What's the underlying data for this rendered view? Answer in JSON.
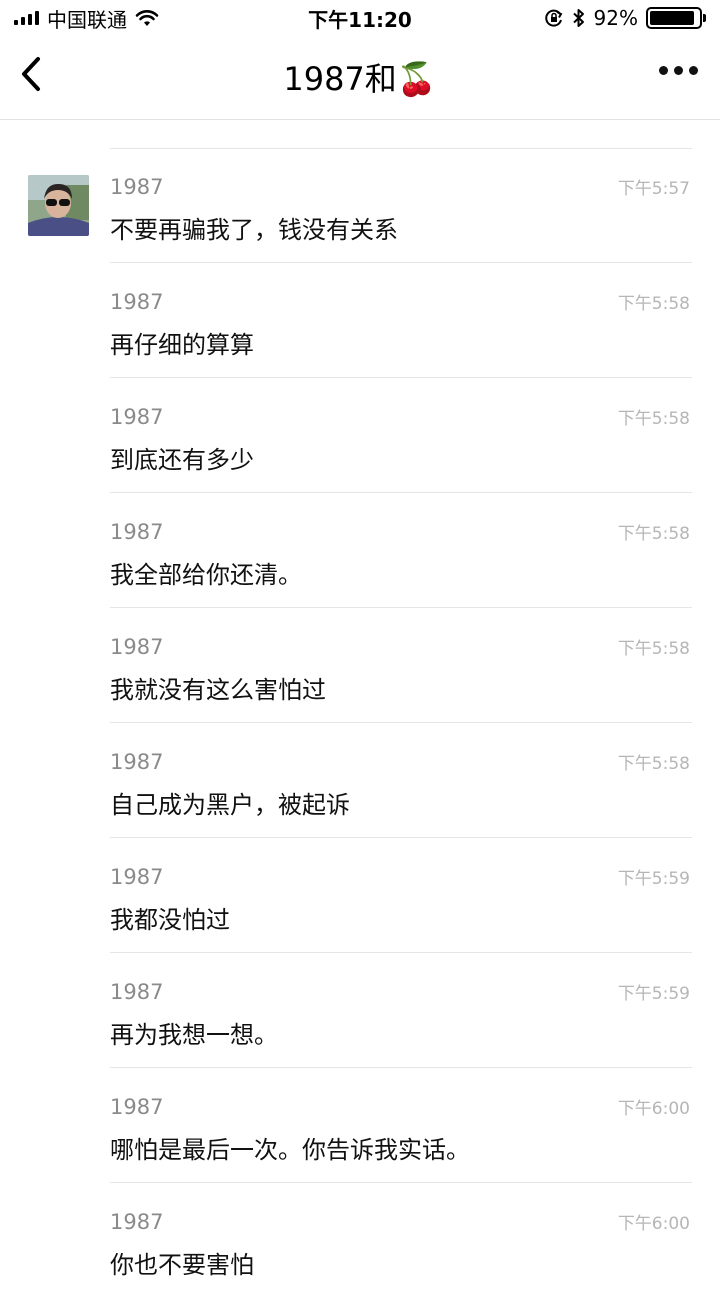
{
  "status_bar": {
    "carrier": "中国联通",
    "time": "下午11:20",
    "battery": "92%",
    "battery_level": 0.92
  },
  "nav": {
    "title": "1987和🍒",
    "back_icon": "chevron-left-icon",
    "more_icon": "more-dots-icon"
  },
  "messages": [
    {
      "sender": "1987",
      "text": "不要再骗我了，钱没有关系",
      "time": "下午5:57",
      "show_avatar": true
    },
    {
      "sender": "1987",
      "text": "再仔细的算算",
      "time": "下午5:58"
    },
    {
      "sender": "1987",
      "text": "到底还有多少",
      "time": "下午5:58"
    },
    {
      "sender": "1987",
      "text": "我全部给你还清。",
      "time": "下午5:58"
    },
    {
      "sender": "1987",
      "text": "我就没有这么害怕过",
      "time": "下午5:58"
    },
    {
      "sender": "1987",
      "text": "自己成为黑户，被起诉",
      "time": "下午5:58"
    },
    {
      "sender": "1987",
      "text": "我都没怕过",
      "time": "下午5:59"
    },
    {
      "sender": "1987",
      "text": "再为我想一想。",
      "time": "下午5:59"
    },
    {
      "sender": "1987",
      "text": "哪怕是最后一次。你告诉我实话。",
      "time": "下午6:00"
    },
    {
      "sender": "1987",
      "text": "你也不要害怕",
      "time": "下午6:00"
    }
  ]
}
